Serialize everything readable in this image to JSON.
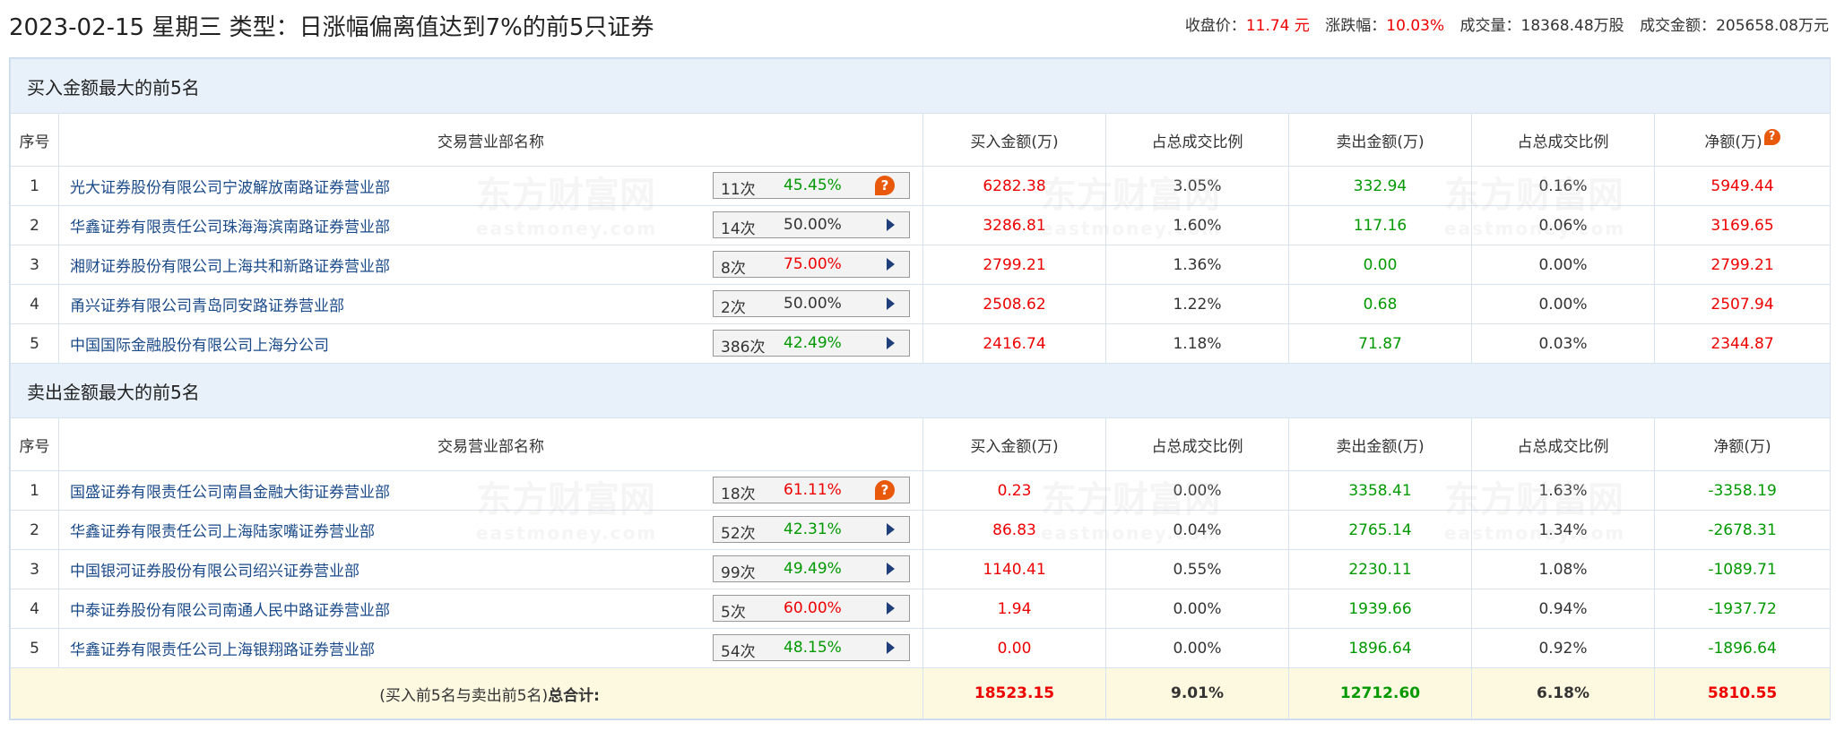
{
  "header": {
    "title": "2023-02-15 星期三 类型：日涨幅偏离值达到7%的前5只证券",
    "close_label": "收盘价：",
    "close_value": "11.74 元",
    "change_label": "涨跌幅：",
    "change_value": "10.03%",
    "volume_label": "成交量：",
    "volume_value": "18368.48万股",
    "amount_label": "成交金额：",
    "amount_value": "205658.08万元"
  },
  "watermark": {
    "cn": "东方财富网",
    "en": "eastmoney.com"
  },
  "columns": {
    "index": "序号",
    "name": "交易营业部名称",
    "buy": "买入金额(万)",
    "buy_ratio": "占总成交比例",
    "sell": "卖出金额(万)",
    "sell_ratio": "占总成交比例",
    "net": "净额(万)"
  },
  "buy_section": {
    "title": "买入金额最大的前5名",
    "rows": [
      {
        "idx": "1",
        "name": "光大证券股份有限公司宁波解放南路证券营业部",
        "count": "11次",
        "pct": "45.45%",
        "pct_color": "green",
        "icon": "question-icon",
        "buy": "6282.38",
        "buy_ratio": "3.05%",
        "sell": "332.94",
        "sell_ratio": "0.16%",
        "net": "5949.44"
      },
      {
        "idx": "2",
        "name": "华鑫证券有限责任公司珠海海滨南路证券营业部",
        "count": "14次",
        "pct": "50.00%",
        "pct_color": "dark",
        "icon": "play-icon",
        "buy": "3286.81",
        "buy_ratio": "1.60%",
        "sell": "117.16",
        "sell_ratio": "0.06%",
        "net": "3169.65"
      },
      {
        "idx": "3",
        "name": "湘财证券股份有限公司上海共和新路证券营业部",
        "count": "8次",
        "pct": "75.00%",
        "pct_color": "red",
        "icon": "play-icon",
        "buy": "2799.21",
        "buy_ratio": "1.36%",
        "sell": "0.00",
        "sell_ratio": "0.00%",
        "net": "2799.21"
      },
      {
        "idx": "4",
        "name": "甬兴证券有限公司青岛同安路证券营业部",
        "count": "2次",
        "pct": "50.00%",
        "pct_color": "dark",
        "icon": "play-icon",
        "buy": "2508.62",
        "buy_ratio": "1.22%",
        "sell": "0.68",
        "sell_ratio": "0.00%",
        "net": "2507.94"
      },
      {
        "idx": "5",
        "name": "中国国际金融股份有限公司上海分公司",
        "count": "386次",
        "pct": "42.49%",
        "pct_color": "green",
        "icon": "play-icon",
        "buy": "2416.74",
        "buy_ratio": "1.18%",
        "sell": "71.87",
        "sell_ratio": "0.03%",
        "net": "2344.87"
      }
    ]
  },
  "sell_section": {
    "title": "卖出金额最大的前5名",
    "rows": [
      {
        "idx": "1",
        "name": "国盛证券有限责任公司南昌金融大街证券营业部",
        "count": "18次",
        "pct": "61.11%",
        "pct_color": "red",
        "icon": "question-icon",
        "buy": "0.23",
        "buy_ratio": "0.00%",
        "sell": "3358.41",
        "sell_ratio": "1.63%",
        "net": "-3358.19"
      },
      {
        "idx": "2",
        "name": "华鑫证券有限责任公司上海陆家嘴证券营业部",
        "count": "52次",
        "pct": "42.31%",
        "pct_color": "green",
        "icon": "play-icon",
        "buy": "86.83",
        "buy_ratio": "0.04%",
        "sell": "2765.14",
        "sell_ratio": "1.34%",
        "net": "-2678.31"
      },
      {
        "idx": "3",
        "name": "中国银河证券股份有限公司绍兴证券营业部",
        "count": "99次",
        "pct": "49.49%",
        "pct_color": "green",
        "icon": "play-icon",
        "buy": "1140.41",
        "buy_ratio": "0.55%",
        "sell": "2230.11",
        "sell_ratio": "1.08%",
        "net": "-1089.71"
      },
      {
        "idx": "4",
        "name": "中泰证券股份有限公司南通人民中路证券营业部",
        "count": "5次",
        "pct": "60.00%",
        "pct_color": "red",
        "icon": "play-icon",
        "buy": "1.94",
        "buy_ratio": "0.00%",
        "sell": "1939.66",
        "sell_ratio": "0.94%",
        "net": "-1937.72"
      },
      {
        "idx": "5",
        "name": "华鑫证券有限责任公司上海银翔路证券营业部",
        "count": "54次",
        "pct": "48.15%",
        "pct_color": "green",
        "icon": "play-icon",
        "buy": "0.00",
        "buy_ratio": "0.00%",
        "sell": "1896.64",
        "sell_ratio": "0.92%",
        "net": "-1896.64"
      }
    ]
  },
  "total": {
    "label_prefix": "(买入前5名与卖出前5名)",
    "label_bold": "总合计:",
    "buy": "18523.15",
    "buy_ratio": "9.01%",
    "sell": "12712.60",
    "sell_ratio": "6.18%",
    "net": "5810.55"
  },
  "colors": {
    "buy": "#e00000",
    "sell": "#009900",
    "header_bg": "#e8f1fa",
    "total_bg": "#fdf8e0",
    "icon": "#e8590c"
  }
}
